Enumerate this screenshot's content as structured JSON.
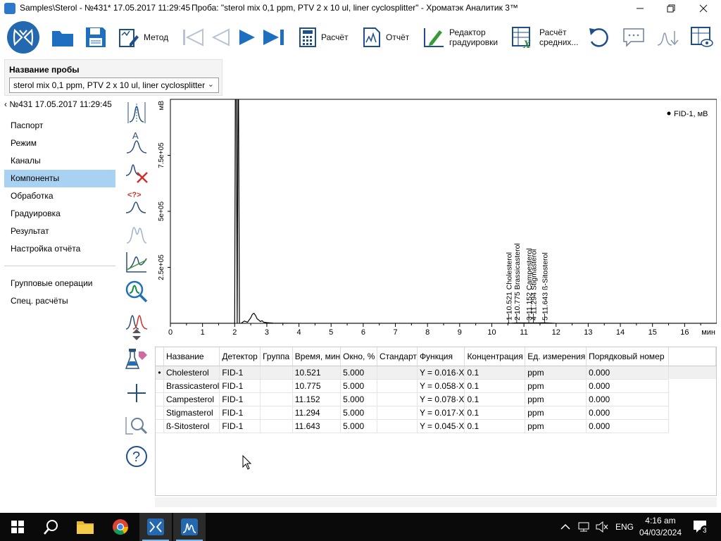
{
  "window": {
    "title_left": "Samples\\Sterol - №431* 17.05.2017 11:29:45",
    "title_mid": "Проба: \"sterol mix 0,1 ppm, PTV 2 x 10 ul, liner cyclosplitter\" - Хроматэк Аналитик 3™",
    "controls": [
      "minimize",
      "maximize",
      "close"
    ]
  },
  "toolbar": {
    "method": "Метод",
    "calc": "Расчёт",
    "report": "Отчёт",
    "calib_editor": [
      "Редактор",
      "градуировки"
    ],
    "avg_calc": [
      "Расчёт",
      "средних..."
    ]
  },
  "sample": {
    "label": "Название пробы",
    "value": "sterol mix 0,1 ppm, PTV 2 x 10 ul, liner cyclosplitter"
  },
  "nav": {
    "back": "№431 17.05.2017 11:29:45",
    "items": [
      {
        "label": "Паспорт"
      },
      {
        "label": "Режим"
      },
      {
        "label": "Каналы"
      },
      {
        "label": "Компоненты",
        "active": true
      },
      {
        "label": "Обработка"
      },
      {
        "label": "Градуировка"
      },
      {
        "label": "Результат"
      },
      {
        "label": "Настройка отчёта"
      }
    ],
    "items2": [
      {
        "label": "Групповые операции"
      },
      {
        "label": "Спец. расчёты"
      }
    ]
  },
  "chart_data": {
    "type": "line",
    "legend": "FID-1, мВ",
    "legend_position": "top-right",
    "ylabel": "мВ",
    "xlabel": "мин",
    "xlim": [
      0,
      17
    ],
    "ylim": [
      0,
      1000000
    ],
    "xticks": [
      "0",
      "1",
      "2",
      "3",
      "4",
      "5",
      "6",
      "7",
      "8",
      "9",
      "10",
      "11",
      "12",
      "13",
      "14",
      "15",
      "16"
    ],
    "yticks": [
      {
        "v": 250000,
        "label": "2.5e+05"
      },
      {
        "v": 500000,
        "label": "5e+05"
      },
      {
        "v": 750000,
        "label": "7.5e+05"
      }
    ],
    "series": [
      {
        "name": "FID-1, мВ",
        "x": [
          0.0,
          1.9,
          2.0,
          2.02,
          2.05,
          2.08,
          2.1,
          2.12,
          2.15,
          2.2,
          2.3,
          2.4,
          2.5,
          2.55,
          2.6,
          2.65,
          2.7,
          2.75,
          2.8,
          2.85,
          2.9,
          3.0,
          3.1,
          3.2,
          3.5,
          4.0,
          5.0,
          10.5,
          10.52,
          10.55,
          10.78,
          11.15,
          11.3,
          11.65,
          12.0,
          17.0
        ],
        "y": [
          0,
          0,
          0,
          1000000,
          1000000,
          0,
          1000000,
          1000000,
          0,
          0,
          10000,
          5000,
          25000,
          40000,
          45000,
          35000,
          20000,
          15000,
          8000,
          12000,
          5000,
          3000,
          2000,
          1000,
          500,
          0,
          0,
          0,
          3000,
          0,
          2000,
          1500,
          1500,
          2500,
          0,
          0
        ]
      }
    ],
    "peaks": [
      {
        "n": "1",
        "rt": "10.521",
        "name": "Cholesterol"
      },
      {
        "n": "2",
        "rt": "10.775",
        "name": "Brassicasterol"
      },
      {
        "n": "3",
        "rt": "11.152",
        "name": "Campesterol"
      },
      {
        "n": "4",
        "rt": "11.294",
        "name": "Stigmasterol"
      },
      {
        "n": "5",
        "rt": "11.643",
        "name": "ß-Sitosterol"
      }
    ]
  },
  "table": {
    "columns": [
      "Название",
      "Детектор",
      "Группа",
      "Время, мин",
      "Окно, %",
      "Стандарт",
      "Функция",
      "Концентрация",
      "Ед. измерения",
      "Порядковый номер"
    ],
    "rows": [
      [
        "Cholesterol",
        "FID-1",
        "",
        "10.521",
        "5.000",
        "",
        "Y = 0.016·X",
        "0.1",
        "ppm",
        "0.000"
      ],
      [
        "Brassicasterol",
        "FID-1",
        "",
        "10.775",
        "5.000",
        "",
        "Y = 0.058·X",
        "0.1",
        "ppm",
        "0.000"
      ],
      [
        "Campesterol",
        "FID-1",
        "",
        "11.152",
        "5.000",
        "",
        "Y = 0.078·X",
        "0.1",
        "ppm",
        "0.000"
      ],
      [
        "Stigmasterol",
        "FID-1",
        "",
        "11.294",
        "5.000",
        "",
        "Y = 0.017·X",
        "0.1",
        "ppm",
        "0.000"
      ],
      [
        "ß-Sitosterol",
        "FID-1",
        "",
        "11.643",
        "5.000",
        "",
        "Y = 0.045·X",
        "0.1",
        "ppm",
        "0.000"
      ]
    ],
    "selected_marker": "•"
  },
  "taskbar": {
    "lang": "ENG",
    "time": "4:16 am",
    "date": "04/03/2024",
    "notifications": "3"
  },
  "colors": {
    "accent": "#2468b0",
    "nav_active": "#a9d1f1",
    "icon_blue": "#1f6fc0",
    "plot_line": "#000000"
  }
}
